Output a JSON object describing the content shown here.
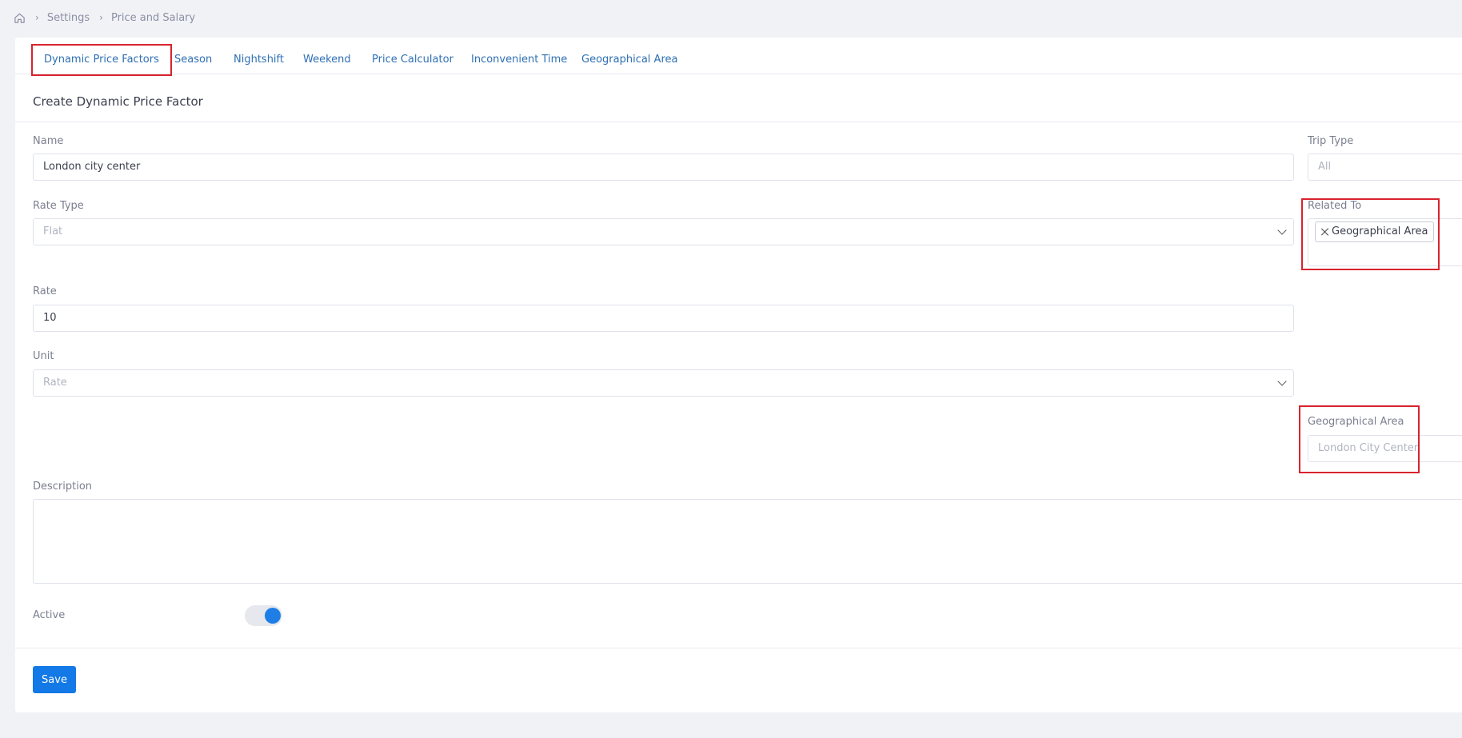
{
  "breadcrumb": {
    "home_icon": "home-icon",
    "items": [
      "Settings",
      "Price and Salary"
    ]
  },
  "tabs": [
    {
      "label": "Dynamic Price Factors",
      "active": true
    },
    {
      "label": "Season"
    },
    {
      "label": "Nightshift"
    },
    {
      "label": "Weekend"
    },
    {
      "label": "Price Calculator"
    },
    {
      "label": "Inconvenient Time"
    },
    {
      "label": "Geographical Area"
    }
  ],
  "form": {
    "title": "Create Dynamic Price Factor",
    "name": {
      "label": "Name",
      "value": "London city center"
    },
    "trip_type": {
      "label": "Trip Type",
      "value": "All"
    },
    "rate_type": {
      "label": "Rate Type",
      "value": "Flat"
    },
    "related_to": {
      "label": "Related To",
      "tags": [
        "Geographical Area"
      ]
    },
    "rate": {
      "label": "Rate",
      "value": "10"
    },
    "unit": {
      "label": "Unit",
      "value": "Rate"
    },
    "geographical_area": {
      "label": "Geographical Area",
      "value": "London City Center"
    },
    "description": {
      "label": "Description",
      "value": ""
    },
    "active": {
      "label": "Active",
      "on": true
    },
    "save_label": "Save"
  },
  "colors": {
    "accent": "#1279e6",
    "highlight_box": "#d9232e",
    "tab_text": "#2e6fb3"
  }
}
